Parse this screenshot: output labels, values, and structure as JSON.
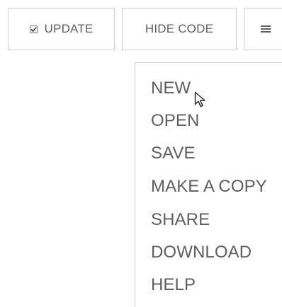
{
  "toolbar": {
    "update": {
      "label": "UPDATE",
      "icon": "checkbox-icon"
    },
    "hide_code": {
      "label": "HIDE CODE"
    },
    "menu": {
      "icon": "hamburger-icon"
    }
  },
  "dropdown": {
    "items": [
      {
        "label": "NEW"
      },
      {
        "label": "OPEN"
      },
      {
        "label": "SAVE"
      },
      {
        "label": "MAKE A COPY"
      },
      {
        "label": "SHARE"
      },
      {
        "label": "DOWNLOAD"
      },
      {
        "label": "HELP"
      }
    ]
  },
  "cursor": {
    "icon": "mouse-pointer-icon"
  },
  "colors": {
    "text": "#5f5f5f",
    "border": "#cfcfcf",
    "background": "#ffffff"
  }
}
